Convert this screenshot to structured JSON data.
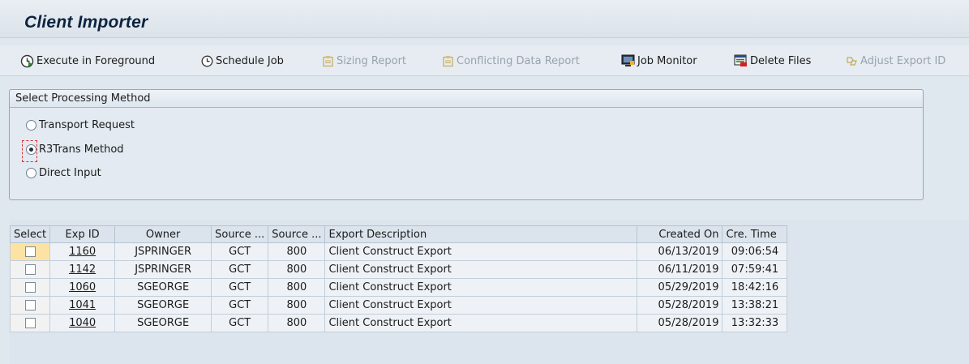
{
  "header": {
    "title": "Client Importer"
  },
  "toolbar": {
    "buttons": [
      {
        "label": "Execute in Foreground",
        "icon": "execute-icon",
        "enabled": true
      },
      {
        "label": "Schedule Job",
        "icon": "clock-icon",
        "enabled": true
      },
      {
        "label": "Sizing Report",
        "icon": "clipboard-icon",
        "enabled": false
      },
      {
        "label": "Conflicting Data Report",
        "icon": "clipboard-icon",
        "enabled": false
      },
      {
        "label": "Job Monitor",
        "icon": "monitor-icon",
        "enabled": true
      },
      {
        "label": "Delete Files",
        "icon": "delete-files-icon",
        "enabled": true
      },
      {
        "label": "Adjust Export ID",
        "icon": "adjust-icon",
        "enabled": false
      }
    ]
  },
  "processing": {
    "group_title": "Select Processing Method",
    "options": [
      {
        "label": "Transport Request",
        "selected": false
      },
      {
        "label": "R3Trans Method",
        "selected": true
      },
      {
        "label": "Direct Input",
        "selected": false
      }
    ]
  },
  "table": {
    "columns": [
      "Select",
      "Exp ID",
      "Owner",
      "Source ...",
      "Source ...",
      "Export Description",
      "Created On",
      "Cre. Time"
    ],
    "rows": [
      {
        "exp_id": "1160",
        "owner": "JSPRINGER",
        "source1": "GCT",
        "source2": "800",
        "description": "Client Construct Export",
        "created_on": "06/13/2019",
        "time": "09:06:54"
      },
      {
        "exp_id": "1142",
        "owner": "JSPRINGER",
        "source1": "GCT",
        "source2": "800",
        "description": "Client Construct Export",
        "created_on": "06/11/2019",
        "time": "07:59:41"
      },
      {
        "exp_id": "1060",
        "owner": "SGEORGE",
        "source1": "GCT",
        "source2": "800",
        "description": "Client Construct Export",
        "created_on": "05/29/2019",
        "time": "18:42:16"
      },
      {
        "exp_id": "1041",
        "owner": "SGEORGE",
        "source1": "GCT",
        "source2": "800",
        "description": "Client Construct Export",
        "created_on": "05/28/2019",
        "time": "13:38:21"
      },
      {
        "exp_id": "1040",
        "owner": "SGEORGE",
        "source1": "GCT",
        "source2": "800",
        "description": "Client Construct Export",
        "created_on": "05/28/2019",
        "time": "13:32:33"
      }
    ]
  },
  "colors": {
    "title": "#0c2340",
    "focus_outline": "#e03030",
    "selected_cell": "#fde3a3",
    "disabled_text": "#9aa3ad"
  }
}
